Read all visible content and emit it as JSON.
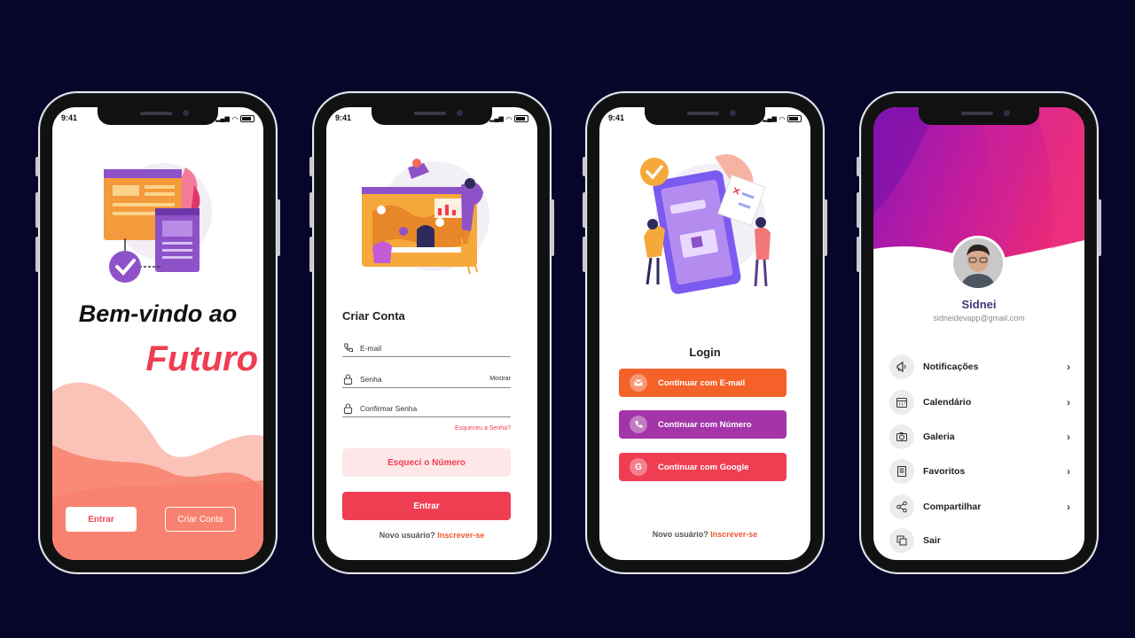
{
  "screens": {
    "s1": {
      "time": "9:41",
      "title_line1": "Bem-vindo ao",
      "title_line2": "Futuro",
      "enter_label": "Entrar",
      "create_label": "Criar Conta"
    },
    "s2": {
      "time": "9:41",
      "title": "Criar Conta",
      "email_label": "E-mail",
      "password_label": "Senha",
      "show_label": "Mostrar",
      "confirm_label": "Confirmar Senha",
      "forgot_password": "Esqueceu a Senha?",
      "forgot_number": "Esqueci o Número",
      "enter_label": "Entrar",
      "new_user": "Novo usuário?",
      "signup": "Inscrever-se"
    },
    "s3": {
      "time": "9:41",
      "title": "Login",
      "email_btn": "Continuar com E-mail",
      "number_btn": "Continuar com Número",
      "google_btn": "Continuar com Google",
      "new_user": "Novo usuário?",
      "signup": "Inscrever-se"
    },
    "s4": {
      "name": "Sidnei",
      "email": "sidneidevapp@gmail.com",
      "menu": [
        {
          "label": "Notificações",
          "icon": "megaphone-icon"
        },
        {
          "label": "Calendário",
          "icon": "calendar-icon"
        },
        {
          "label": "Galeria",
          "icon": "camera-icon"
        },
        {
          "label": "Favoritos",
          "icon": "book-icon"
        },
        {
          "label": "Compartilhar",
          "icon": "share-icon"
        },
        {
          "label": "Sair",
          "icon": "logout-icon"
        }
      ]
    }
  },
  "colors": {
    "background": "#05062a",
    "primary_red": "#ef3d52",
    "orange": "#f4622a",
    "purple": "#a335a8",
    "name_color": "#3c3a7a"
  }
}
